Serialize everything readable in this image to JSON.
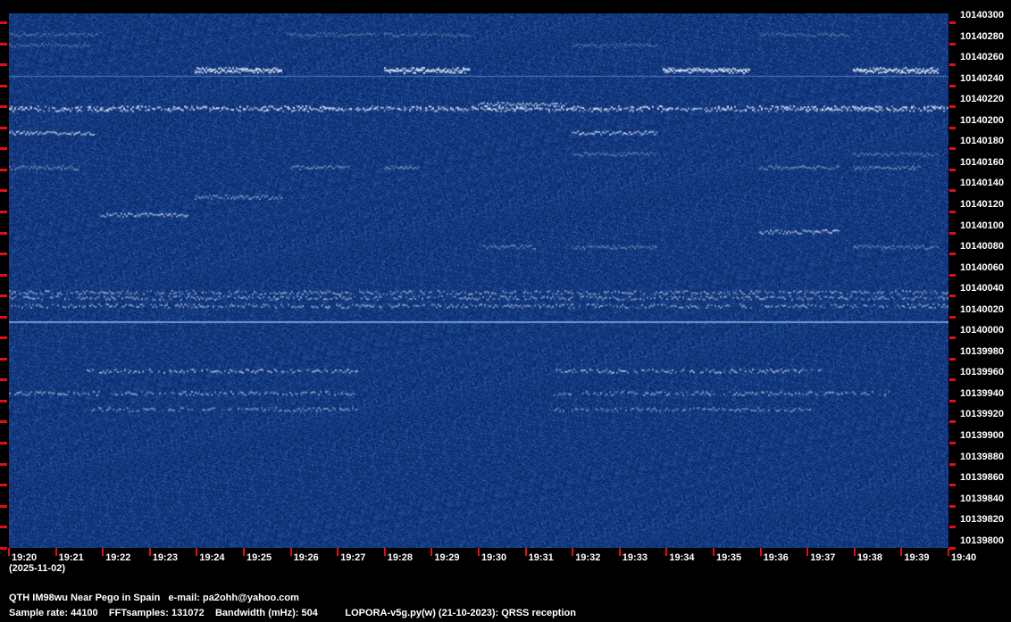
{
  "y_axis_labels": [
    "10140300",
    "10140280",
    "10140260",
    "10140240",
    "10140220",
    "10140200",
    "10140180",
    "10140160",
    "10140140",
    "10140120",
    "10140100",
    "10140080",
    "10140060",
    "10140040",
    "10140020",
    "10140000",
    "10139980",
    "10139960",
    "10139940",
    "10139920",
    "10139900",
    "10139880",
    "10139860",
    "10139840",
    "10139820",
    "10139800"
  ],
  "x_axis_labels": [
    "19:20",
    "19:21",
    "19:22",
    "19:23",
    "19:24",
    "19:25",
    "19:26",
    "19:27",
    "19:28",
    "19:29",
    "19:30",
    "19:31",
    "19:32",
    "19:33",
    "19:34",
    "19:35",
    "19:36",
    "19:37",
    "19:38",
    "19:39",
    "19:40"
  ],
  "date": "(2025-11-02)",
  "footer": {
    "qth": "QTH IM98wu Near Pego in Spain",
    "email": "e-mail: pa2ohh@yahoo.com",
    "sample_rate": "Sample rate: 44100",
    "fft_samples": "FFTsamples: 131072",
    "bandwidth": "Bandwidth (mHz): 504",
    "software": "LOPORA-v5g.py(w) (21-10-2023): QRSS reception"
  },
  "colors": {
    "background": "#0f3478",
    "signal": "#e8f0ff",
    "tick": "#e01010"
  }
}
